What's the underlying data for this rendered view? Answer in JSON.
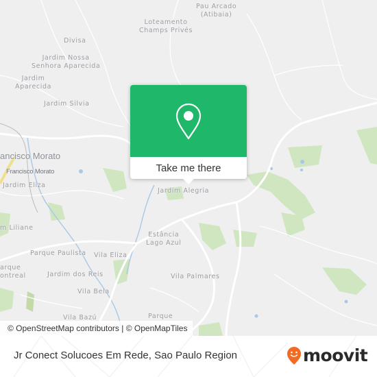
{
  "map": {
    "places": [
      {
        "id": "pau-arcado",
        "text": "Pau Arcado\n(Atibaia)"
      },
      {
        "id": "loteamento",
        "text": "Loteamento\nChamps Privés"
      },
      {
        "id": "divisa",
        "text": "Divisa"
      },
      {
        "id": "jardim-nossa-senhora",
        "text": "Jardim Nossa\nSenhora Aparecida"
      },
      {
        "id": "jardim-aparecida",
        "text": "Jardim\nAparecida"
      },
      {
        "id": "jardim-silvia",
        "text": "Jardim Silvia"
      },
      {
        "id": "francisco-morato-city",
        "text": "ancisco Morato"
      },
      {
        "id": "francisco-morato-station",
        "text": "Francisco Morato"
      },
      {
        "id": "jardim-eliza",
        "text": "Jardim Eliza"
      },
      {
        "id": "jardim-alegria",
        "text": "Jardim Alegria"
      },
      {
        "id": "jardim-liliane",
        "text": "m Liliane"
      },
      {
        "id": "estancia-lago-azul",
        "text": "Estância\nLago Azul"
      },
      {
        "id": "parque-paulista",
        "text": "Parque Paulista"
      },
      {
        "id": "vila-eliza",
        "text": "Vila Eliza"
      },
      {
        "id": "parque-montreal",
        "text": "arque\nontreal"
      },
      {
        "id": "jardim-dos-reis",
        "text": "Jardim dos Reis"
      },
      {
        "id": "vila-palmares",
        "text": "Vila Palmares"
      },
      {
        "id": "vila-bela",
        "text": "Vila Bela"
      },
      {
        "id": "vila-bazu",
        "text": "Vila Bazú"
      },
      {
        "id": "parque",
        "text": "Parque"
      }
    ],
    "colors": {
      "background": "#efefef",
      "park": "#cfe6c0",
      "water": "#a9c8e6",
      "road": "#ffffff",
      "highway": "#f1e08a"
    }
  },
  "popup": {
    "icon": "map-pin-icon",
    "button_label": "Take me there",
    "accent": "#1fb86a"
  },
  "attribution": {
    "text": "© OpenStreetMap contributors | © OpenMapTiles"
  },
  "footer": {
    "title": "Jr Conect Solucoes Em Rede, Sao Paulo Region",
    "logo_text": "moovit",
    "logo_icon": "moovit-pin-icon",
    "logo_color": "#f26b24"
  }
}
